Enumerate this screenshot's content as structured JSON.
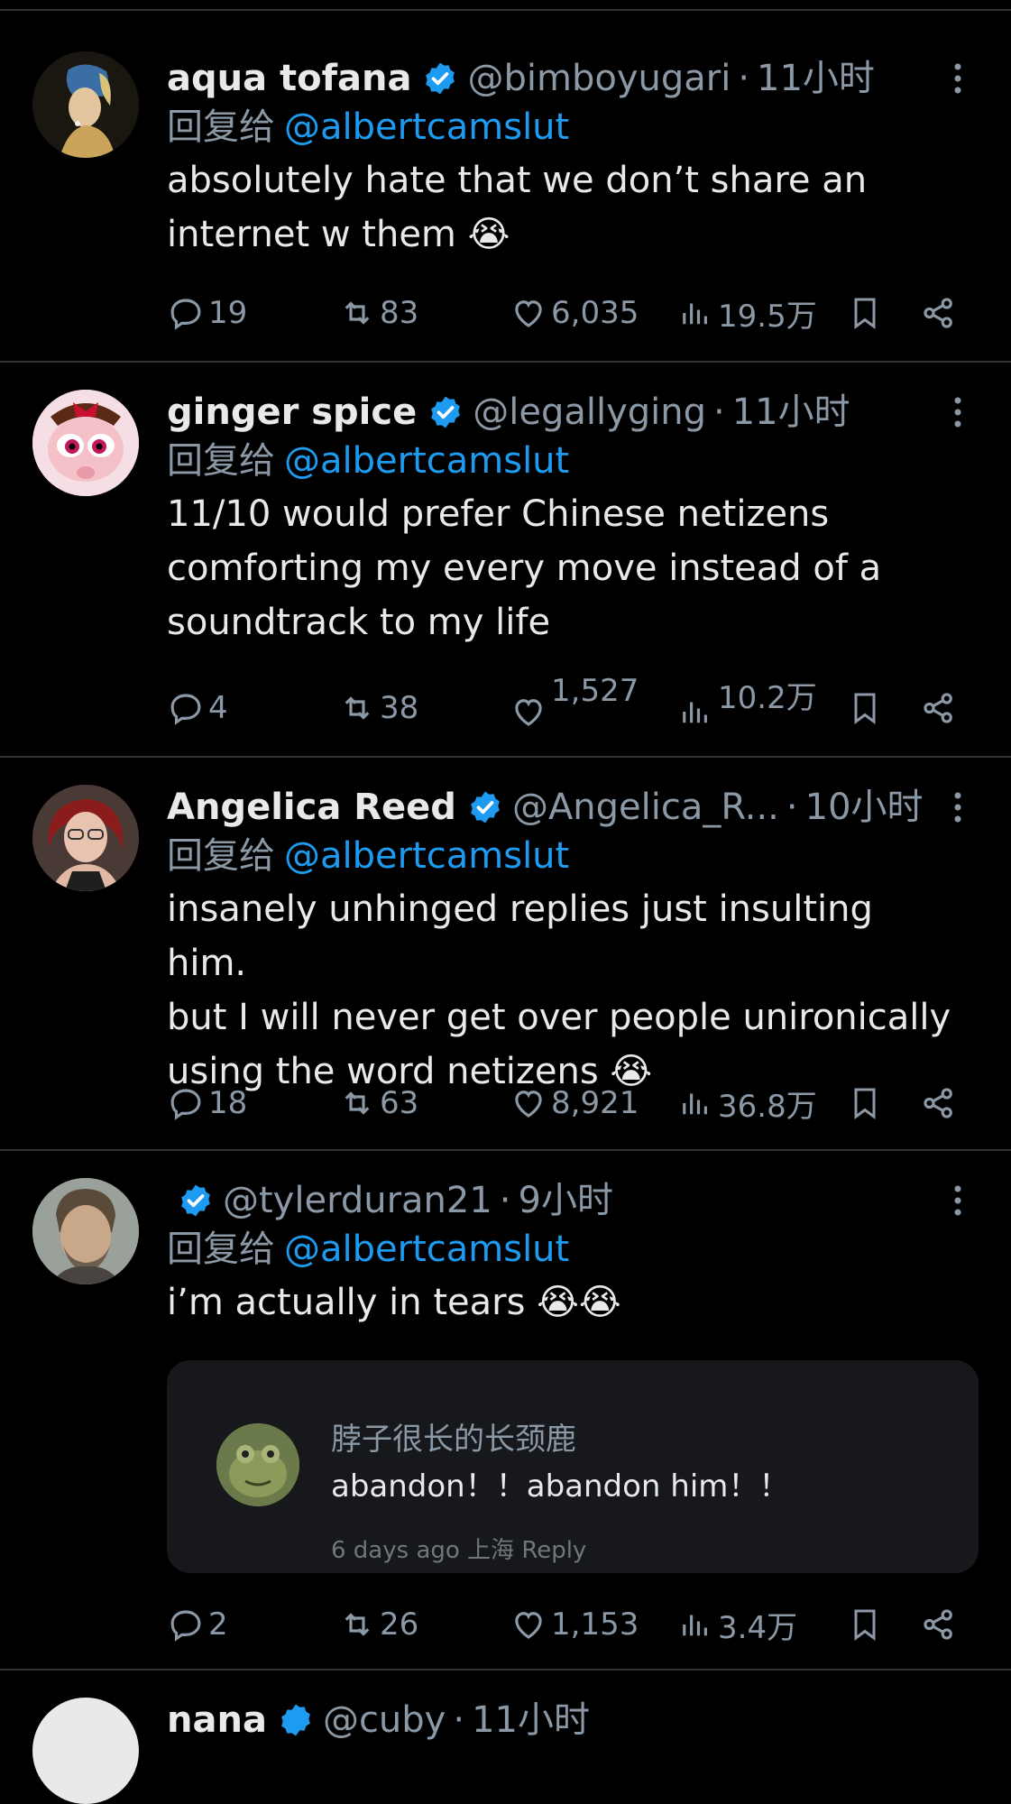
{
  "tweets": [
    {
      "name": "aqua tofana",
      "handle": "@bimboyugari",
      "time": "11小时",
      "reply_prefix": "回复给",
      "reply_to": "@albertcamslut",
      "text": "absolutely hate that we don’t share an\ninternet w them 😭",
      "replies": "19",
      "retweets": "83",
      "likes": "6,035",
      "views": "19.5万"
    },
    {
      "name": "ginger spice",
      "handle": "@legallyging",
      "time": "11小时",
      "reply_prefix": "回复给",
      "reply_to": "@albertcamslut",
      "text": "11/10 would prefer Chinese netizens\ncomforting my every move instead of a\nsoundtrack to my life",
      "replies": "4",
      "retweets": "38",
      "likes": "1,527",
      "views": "10.2万"
    },
    {
      "name": "Angelica Reed",
      "handle": "@Angelica_R...",
      "time": "10小时",
      "reply_prefix": "回复给",
      "reply_to": "@albertcamslut",
      "text": "insanely unhinged replies just insulting him.\nbut I will never get over people unironically\nusing the word netizens 😭",
      "replies": "18",
      "retweets": "63",
      "likes": "8,921",
      "views": "36.8万"
    },
    {
      "name": "",
      "handle": "@tylerduran21",
      "time": "9小时",
      "reply_prefix": "回复给",
      "reply_to": "@albertcamslut",
      "text": "i’m actually in tears 😭😭",
      "quote": {
        "name": "脖子很长的长颈鹿",
        "text": "abandon！！abandon him！！",
        "meta": "6 days ago 上海 Reply"
      },
      "replies": "2",
      "retweets": "26",
      "likes": "1,153",
      "views": "3.4万"
    }
  ],
  "partial_next": {
    "name": "nana",
    "handle": "@cuby",
    "time": "11小时"
  },
  "colors": {
    "background": "#000000",
    "text": "#e7e9ea",
    "muted": "#8b98a5",
    "link": "#1d9bf0",
    "divider": "#2f3336",
    "verified": "#1d9bf0"
  },
  "icons": [
    "reply-icon",
    "retweet-icon",
    "like-icon",
    "views-icon",
    "bookmark-icon",
    "share-icon",
    "more-icon",
    "verified-badge-icon"
  ]
}
